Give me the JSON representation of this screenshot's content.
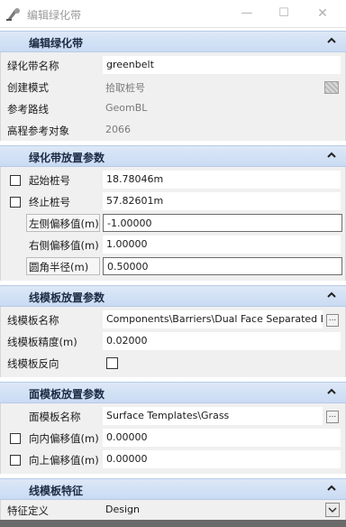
{
  "window": {
    "title": "编辑绿化带",
    "minimize_glyph": "—",
    "maximize_glyph": "☐",
    "close_glyph": "✕"
  },
  "sections": {
    "edit": {
      "title": "编辑绿化带",
      "rows": {
        "name": {
          "label": "绿化带名称",
          "value": "greenbelt"
        },
        "mode": {
          "label": "创建模式",
          "value": "拾取桩号"
        },
        "path": {
          "label": "参考路线",
          "value": "GeomBL"
        },
        "elev": {
          "label": "高程参考对象",
          "value": "2066"
        }
      }
    },
    "placement": {
      "title": "绿化带放置参数",
      "rows": {
        "start": {
          "label": "起始桩号",
          "value": "18.78046m"
        },
        "end": {
          "label": "终止桩号",
          "value": "57.82601m"
        },
        "left": {
          "label": "左侧偏移值(m)",
          "value": "-1.00000"
        },
        "right": {
          "label": "右侧偏移值(m)",
          "value": "1.00000"
        },
        "radius": {
          "label": "圆角半径(m)",
          "value": "0.50000"
        }
      }
    },
    "line_template": {
      "title": "线模板放置参数",
      "rows": {
        "name": {
          "label": "线模板名称",
          "value": "Components\\Barriers\\Dual Face Separated Barrier",
          "button": "..."
        },
        "precision": {
          "label": "线模板精度(m)",
          "value": "0.02000"
        },
        "reverse": {
          "label": "线模板反向"
        }
      }
    },
    "surface_template": {
      "title": "面模板放置参数",
      "rows": {
        "name": {
          "label": "面模板名称",
          "value": "Surface Templates\\Grass",
          "button": "..."
        },
        "inward": {
          "label": "向内偏移值(m)",
          "value": "0.00000"
        },
        "upward": {
          "label": "向上偏移值(m)",
          "value": "0.00000"
        }
      }
    },
    "line_feature": {
      "title": "线模板特征",
      "rows": {
        "feature": {
          "label": "特征定义",
          "value": "Design"
        }
      }
    }
  },
  "colors": {
    "section_header": "#c9dbf3",
    "panel_bg": "#f0f0f0"
  }
}
